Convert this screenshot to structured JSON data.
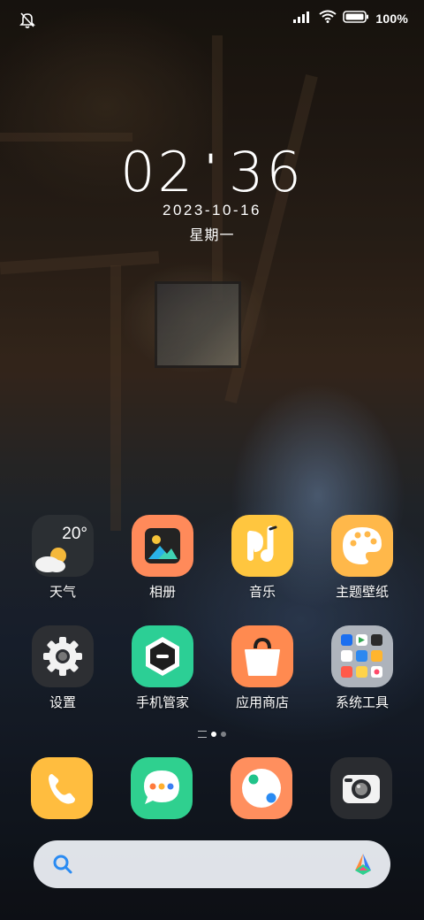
{
  "status_bar": {
    "left_icon": "bell-off-icon",
    "signal_icon": "cellular-signal-icon",
    "wifi_icon": "wifi-icon",
    "battery_icon": "battery-icon",
    "battery_percent": "100%"
  },
  "lockclock": {
    "hour": "02",
    "minute": "36",
    "date": "2023-10-16",
    "weekday": "星期一"
  },
  "weather_widget": {
    "temperature": "20°",
    "icon": "partly-cloudy-icon"
  },
  "apps": [
    {
      "label": "天气",
      "icon": "weather-icon",
      "color": "#2b2f33"
    },
    {
      "label": "相册",
      "icon": "gallery-icon",
      "color": "#ff8a5a"
    },
    {
      "label": "音乐",
      "icon": "music-icon",
      "color": "#ffc63f"
    },
    {
      "label": "主题壁纸",
      "icon": "palette-icon",
      "color": "#ffb84a"
    },
    {
      "label": "设置",
      "icon": "gear-icon",
      "color": "#2d2f33"
    },
    {
      "label": "手机管家",
      "icon": "security-shield-icon",
      "color": "#2ccf95"
    },
    {
      "label": "应用商店",
      "icon": "shopping-bag-icon",
      "color": "#ff8a50"
    },
    {
      "label": "系统工具",
      "icon": "folder-icon",
      "color": "#c8ccd4"
    }
  ],
  "dock": [
    {
      "icon": "phone-icon",
      "color": "#ffbd3f"
    },
    {
      "icon": "messages-icon",
      "color": "#2fd08f"
    },
    {
      "icon": "browser-icon",
      "color": "#ff8f5e"
    },
    {
      "icon": "camera-icon",
      "color": "#2a2c30"
    }
  ],
  "search": {
    "icon": "search-icon",
    "assistant_icon": "assistant-logo-icon"
  },
  "colors": {
    "accent_blue": "#2a8bf2",
    "search_bg": "#ebeef3"
  }
}
